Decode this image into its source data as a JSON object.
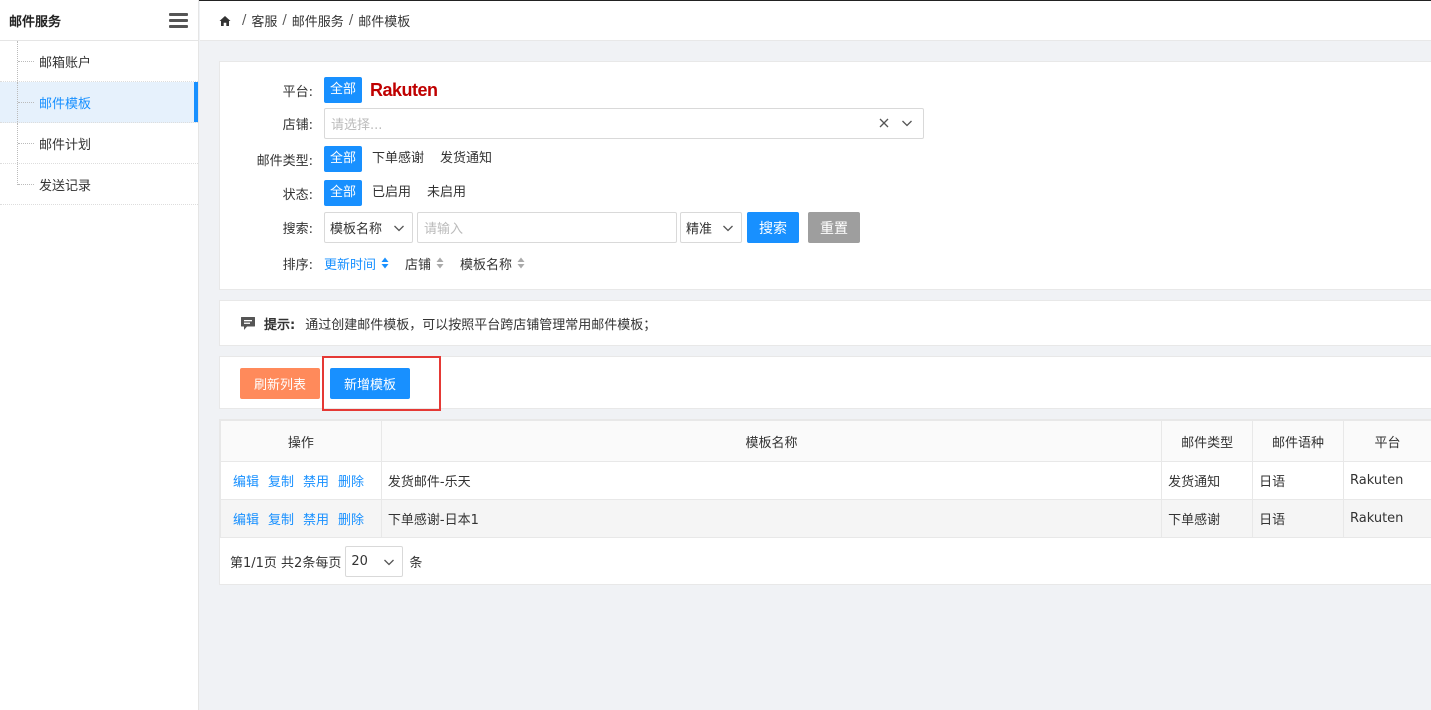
{
  "sidebar": {
    "title": "邮件服务",
    "items": [
      {
        "label": "邮箱账户"
      },
      {
        "label": "邮件模板"
      },
      {
        "label": "邮件计划"
      },
      {
        "label": "发送记录"
      }
    ]
  },
  "breadcrumb": {
    "parts": [
      "客服",
      "邮件服务",
      "邮件模板"
    ]
  },
  "filters": {
    "platform": {
      "label": "平台:",
      "all": "全部",
      "rakuten": "Rakuten"
    },
    "shop": {
      "label": "店铺:",
      "placeholder": "请选择..."
    },
    "mail_type": {
      "label": "邮件类型:",
      "options": [
        "全部",
        "下单感谢",
        "发货通知"
      ]
    },
    "status": {
      "label": "状态:",
      "options": [
        "全部",
        "已启用",
        "未启用"
      ]
    },
    "search": {
      "label": "搜索:",
      "field": "模板名称",
      "placeholder": "请输入",
      "mode": "精准",
      "search_btn": "搜索",
      "reset_btn": "重置"
    },
    "sort": {
      "label": "排序:",
      "options": [
        "更新时间",
        "店铺",
        "模板名称"
      ]
    }
  },
  "tip": {
    "label": "提示:",
    "text": "通过创建邮件模板，可以按照平台跨店铺管理常用邮件模板；"
  },
  "actions": {
    "refresh": "刷新列表",
    "add": "新增模板"
  },
  "table": {
    "headers": [
      "操作",
      "模板名称",
      "邮件类型",
      "邮件语种",
      "平台"
    ],
    "row_actions": [
      "编辑",
      "复制",
      "禁用",
      "删除"
    ],
    "rows": [
      {
        "name": "发货邮件-乐天",
        "type": "发货通知",
        "lang": "日语",
        "platform": "Rakuten"
      },
      {
        "name": "下单感谢-日本1",
        "type": "下单感谢",
        "lang": "日语",
        "platform": "Rakuten"
      }
    ]
  },
  "pager": {
    "info": "第1/1页 共2条每页",
    "size": "20",
    "unit": "条"
  },
  "colors": {
    "primary": "#1890ff",
    "orange": "#ff8a5b",
    "gray": "#9e9e9e",
    "highlight": "#e53935",
    "rakuten": "#bf0000"
  }
}
